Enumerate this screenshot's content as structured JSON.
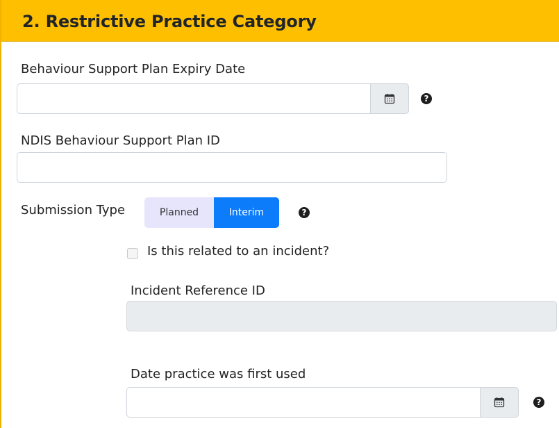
{
  "header": {
    "title": "2. Restrictive Practice Category"
  },
  "bsp_expiry": {
    "label": "Behaviour Support Plan Expiry Date",
    "value": "",
    "icon": "calendar-icon",
    "help_icon": "question-circle-icon"
  },
  "ndis_bsp_id": {
    "label": "NDIS Behaviour Support Plan ID",
    "value": ""
  },
  "submission_type": {
    "label": "Submission Type",
    "options": [
      "Planned",
      "Interim"
    ],
    "selected": "Interim",
    "help_icon": "question-circle-icon"
  },
  "incident_related": {
    "label": "Is this related to an incident?",
    "checked": false
  },
  "incident_reference": {
    "label": "Incident Reference ID",
    "value": "",
    "disabled": true
  },
  "first_used_date": {
    "label": "Date practice was first used",
    "value": "",
    "icon": "calendar-icon",
    "help_icon": "question-circle-icon"
  },
  "colors": {
    "header_bg": "#fdbf00",
    "selected_toggle": "#0d7cfb",
    "unselected_toggle": "#e7e5fb"
  }
}
